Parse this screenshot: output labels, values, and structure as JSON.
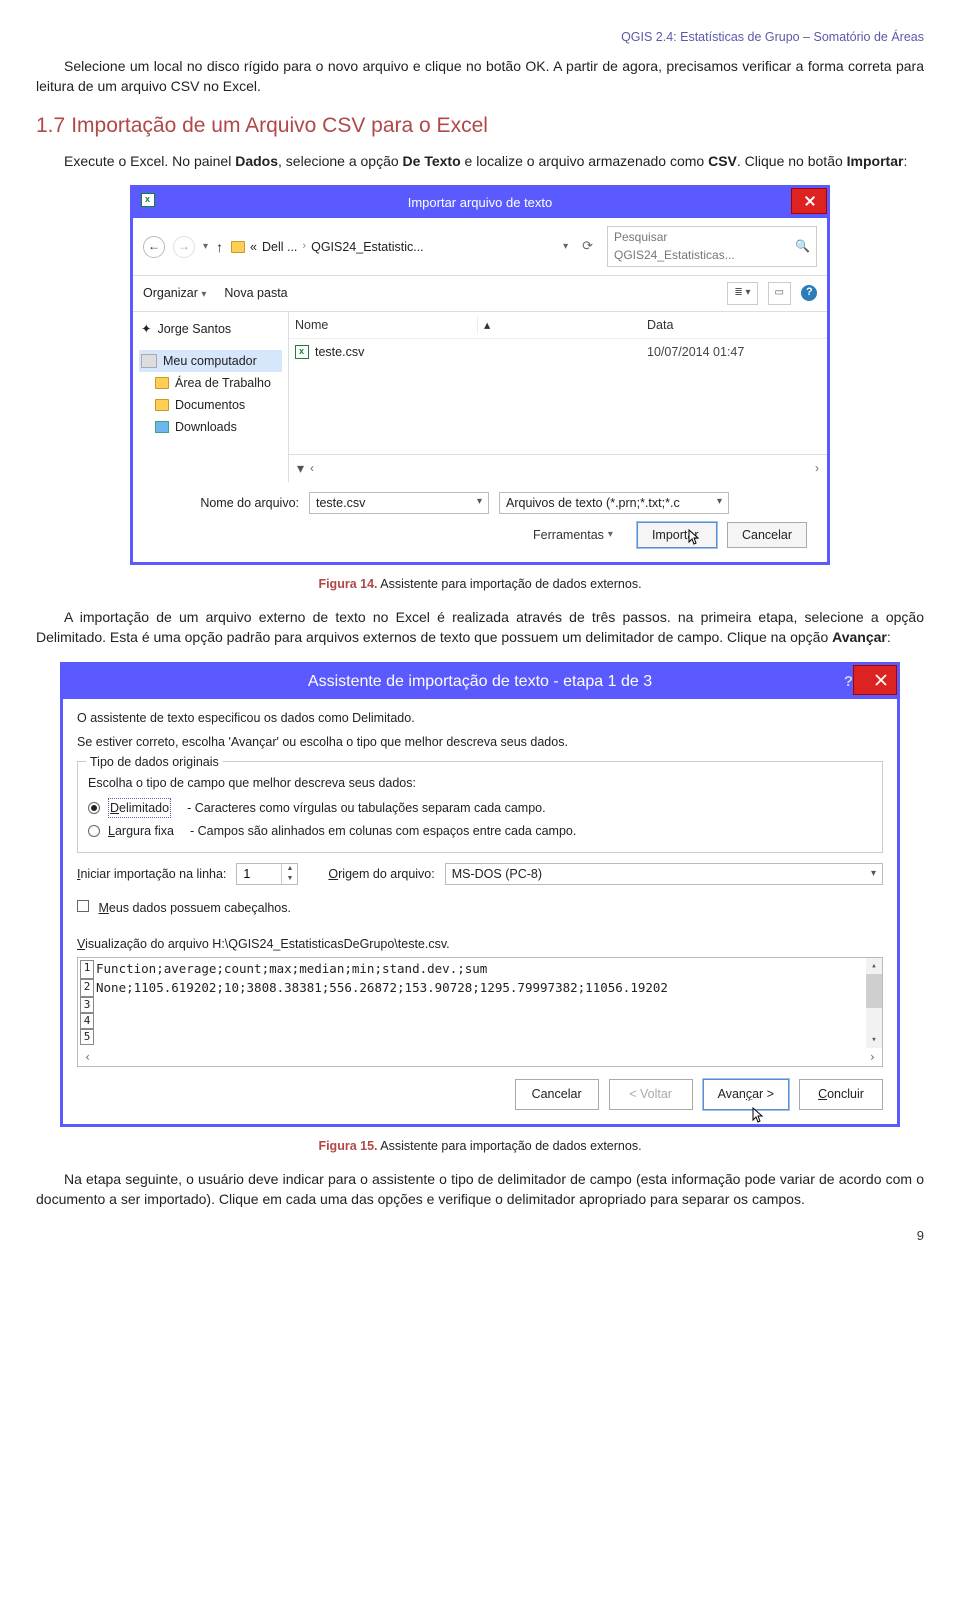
{
  "header_line": "QGIS 2.4: Estatísticas de Grupo – Somatório de Áreas",
  "intro_para": {
    "a": "Selecione um local no disco rígido para o novo arquivo e clique no botão OK. A partir de agora, precisamos verificar a forma correta para leitura de um arquivo CSV no Excel."
  },
  "section_number": "1.7",
  "section_title": "Importação de um Arquivo CSV para o Excel",
  "para2": {
    "a": "Execute o Excel. No painel ",
    "b": "Dados",
    "c": ", selecione a opção ",
    "d": "De Texto",
    "e": " e localize o arquivo armazenado como ",
    "f": "CSV",
    "g": ". Clique no botão ",
    "h": "Importar",
    "i": ":"
  },
  "dialog1": {
    "title": "Importar arquivo de texto",
    "bc1": "Dell ...",
    "bc2": "QGIS24_Estatistic...",
    "search_ph": "Pesquisar QGIS24_Estatisticas...",
    "organize": "Organizar",
    "newfolder": "Nova pasta",
    "side_top": "Jorge Santos",
    "side_pc": "Meu computador",
    "side_desk": "Área de Trabalho",
    "side_docs": "Documentos",
    "side_dl": "Downloads",
    "col_name": "Nome",
    "col_date": "Data",
    "file_name": "teste.csv",
    "file_date": "10/07/2014 01:47",
    "fn_label": "Nome do arquivo:",
    "fn_value": "teste.csv",
    "filter": "Arquivos de texto (*.prn;*.txt;*.c",
    "tools": "Ferramentas",
    "import_btn": "Importar",
    "cancel_btn": "Cancelar"
  },
  "fig14": {
    "label": "Figura 14.",
    "text": " Assistente para importação de dados externos."
  },
  "para3": {
    "a": "A importação de um arquivo externo de texto no Excel é realizada através de três passos. na primeira etapa, selecione a opção Delimitado. Esta é uma opção padrão para arquivos externos de texto que possuem um delimitador de campo. Clique na opção ",
    "b": "Avançar",
    "c": ":"
  },
  "dialog2": {
    "title": "Assistente de importação de texto - etapa 1 de 3",
    "line1": "O assistente de texto especificou os dados como Delimitado.",
    "line2": "Se estiver correto, escolha 'Avançar' ou escolha o tipo que melhor descreva seus dados.",
    "grp_title": "Tipo de dados originais",
    "grp_sub": "Escolha o tipo de campo que melhor descreva seus dados:",
    "r1_u": "D",
    "r1_rest": "elimitado",
    "r1_desc": "- Caracteres como vírgulas ou tabulações separam cada campo.",
    "r2_u": "L",
    "r2_rest": "argura fixa",
    "r2_desc": "- Campos são alinhados em colunas com espaços entre cada campo.",
    "start_u": "I",
    "start_rest": "niciar importação na linha:",
    "start_val": "1",
    "orig_u": "O",
    "orig_rest": "rigem do arquivo:",
    "orig_val": "MS-DOS (PC-8)",
    "hdr_u": "M",
    "hdr_rest": "eus dados possuem cabeçalhos.",
    "pv_u": "V",
    "pv_rest": "isualização do arquivo H:\\QGIS24_EstatisticasDeGrupo\\teste.csv.",
    "pv_l1": "Function;average;count;max;median;min;stand.dev.;sum",
    "pv_l2": "None;1105.619202;10;3808.38381;556.26872;153.90728;1295.79997382;11056.19202",
    "cancel": "Cancelar",
    "back": "< Voltar",
    "next_a": "Avan",
    "next_u": "ç",
    "next_b": "ar >",
    "finish_u": "C",
    "finish_rest": "oncluir"
  },
  "fig15": {
    "label": "Figura 15.",
    "text": " Assistente para importação de dados externos."
  },
  "para4": {
    "a": "Na etapa seguinte, o usuário deve indicar para o assistente o tipo de delimitador de campo (esta informação pode variar de acordo com o documento a ser importado). Clique em cada uma das opções e verifique o delimitador apropriado para separar os campos."
  },
  "page_number": "9"
}
